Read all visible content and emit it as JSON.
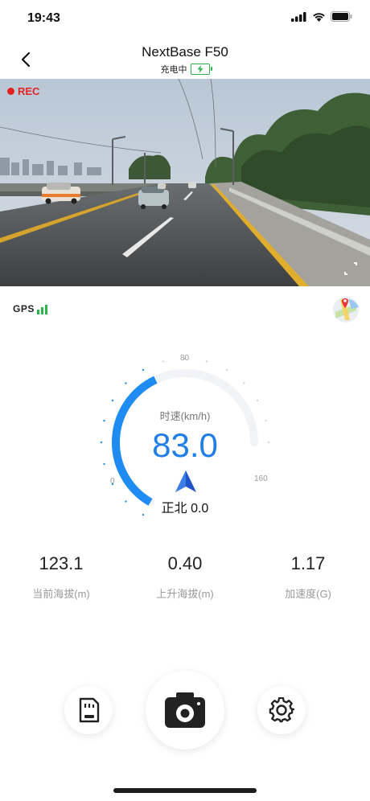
{
  "status_bar": {
    "time": "19:43"
  },
  "header": {
    "title": "NextBase F50",
    "charging_text": "充电中"
  },
  "video": {
    "rec_label": "REC"
  },
  "gps": {
    "label": "GPS"
  },
  "gauge": {
    "speed_label": "时速(km/h)",
    "speed_value": "83.0",
    "tick_min": "0",
    "tick_mid": "80",
    "tick_max": "160",
    "speed_fraction": 0.52,
    "heading_text": "正北 0.0"
  },
  "stats": [
    {
      "value": "123.1",
      "label": "当前海拔(m)"
    },
    {
      "value": "0.40",
      "label": "上升海拔(m)"
    },
    {
      "value": "1.17",
      "label": "加速度(G)"
    }
  ],
  "colors": {
    "accent": "#1f7ee8",
    "rec": "#e32323",
    "charging": "#2cb34a"
  },
  "icons": [
    "back-icon",
    "charging-battery-icon",
    "fullscreen-icon",
    "signal-bars-icon",
    "map-pin-icon",
    "navigation-arrow-icon",
    "sd-card-icon",
    "camera-icon",
    "gear-icon"
  ]
}
